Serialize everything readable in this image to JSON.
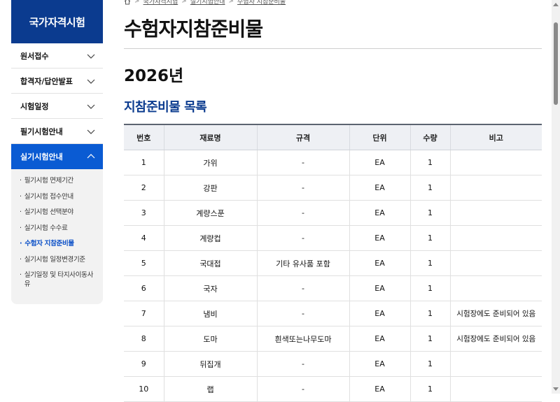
{
  "sidebar": {
    "title": "국가자격시험",
    "menu": [
      {
        "label": "원서접수"
      },
      {
        "label": "합격자/답안발표"
      },
      {
        "label": "시험일정"
      },
      {
        "label": "필기시험안내"
      },
      {
        "label": "실기시험안내"
      }
    ],
    "submenu": [
      "필기시험 면제기간",
      "실기시험 접수안내",
      "실기시험 선택분야",
      "실기시험 수수료",
      "수험자 지참준비물",
      "실기시험 일정변경기준",
      "실기일정 및 타지사이동사유"
    ]
  },
  "breadcrumb": {
    "items": [
      "국가자격시험",
      "실기시험안내",
      "수험자 지참준비물"
    ]
  },
  "page": {
    "title": "수험자지참준비물",
    "year": "2026년",
    "list_title": "지참준비물 목록"
  },
  "table": {
    "headers": [
      "번호",
      "재료명",
      "규격",
      "단위",
      "수량",
      "비고"
    ],
    "rows": [
      [
        "1",
        "가위",
        "-",
        "EA",
        "1",
        ""
      ],
      [
        "2",
        "강판",
        "-",
        "EA",
        "1",
        ""
      ],
      [
        "3",
        "계량스푼",
        "-",
        "EA",
        "1",
        ""
      ],
      [
        "4",
        "계량컵",
        "-",
        "EA",
        "1",
        ""
      ],
      [
        "5",
        "국대접",
        "기타 유사품 포함",
        "EA",
        "1",
        ""
      ],
      [
        "6",
        "국자",
        "-",
        "EA",
        "1",
        ""
      ],
      [
        "7",
        "냄비",
        "-",
        "EA",
        "1",
        "시험장에도 준비되어 있음"
      ],
      [
        "8",
        "도마",
        "흰색또는나무도마",
        "EA",
        "1",
        "시험장에도 준비되어 있음"
      ],
      [
        "9",
        "뒤집개",
        "-",
        "EA",
        "1",
        ""
      ],
      [
        "10",
        "랩",
        "-",
        "EA",
        "1",
        ""
      ]
    ]
  },
  "colors": {
    "brand_navy": "#0b3b8f",
    "active_blue": "#0a5bd3"
  },
  "icons": {
    "home": "home-icon",
    "chevron_down": "chevron-down-icon",
    "chevron_up": "chevron-up-icon"
  }
}
